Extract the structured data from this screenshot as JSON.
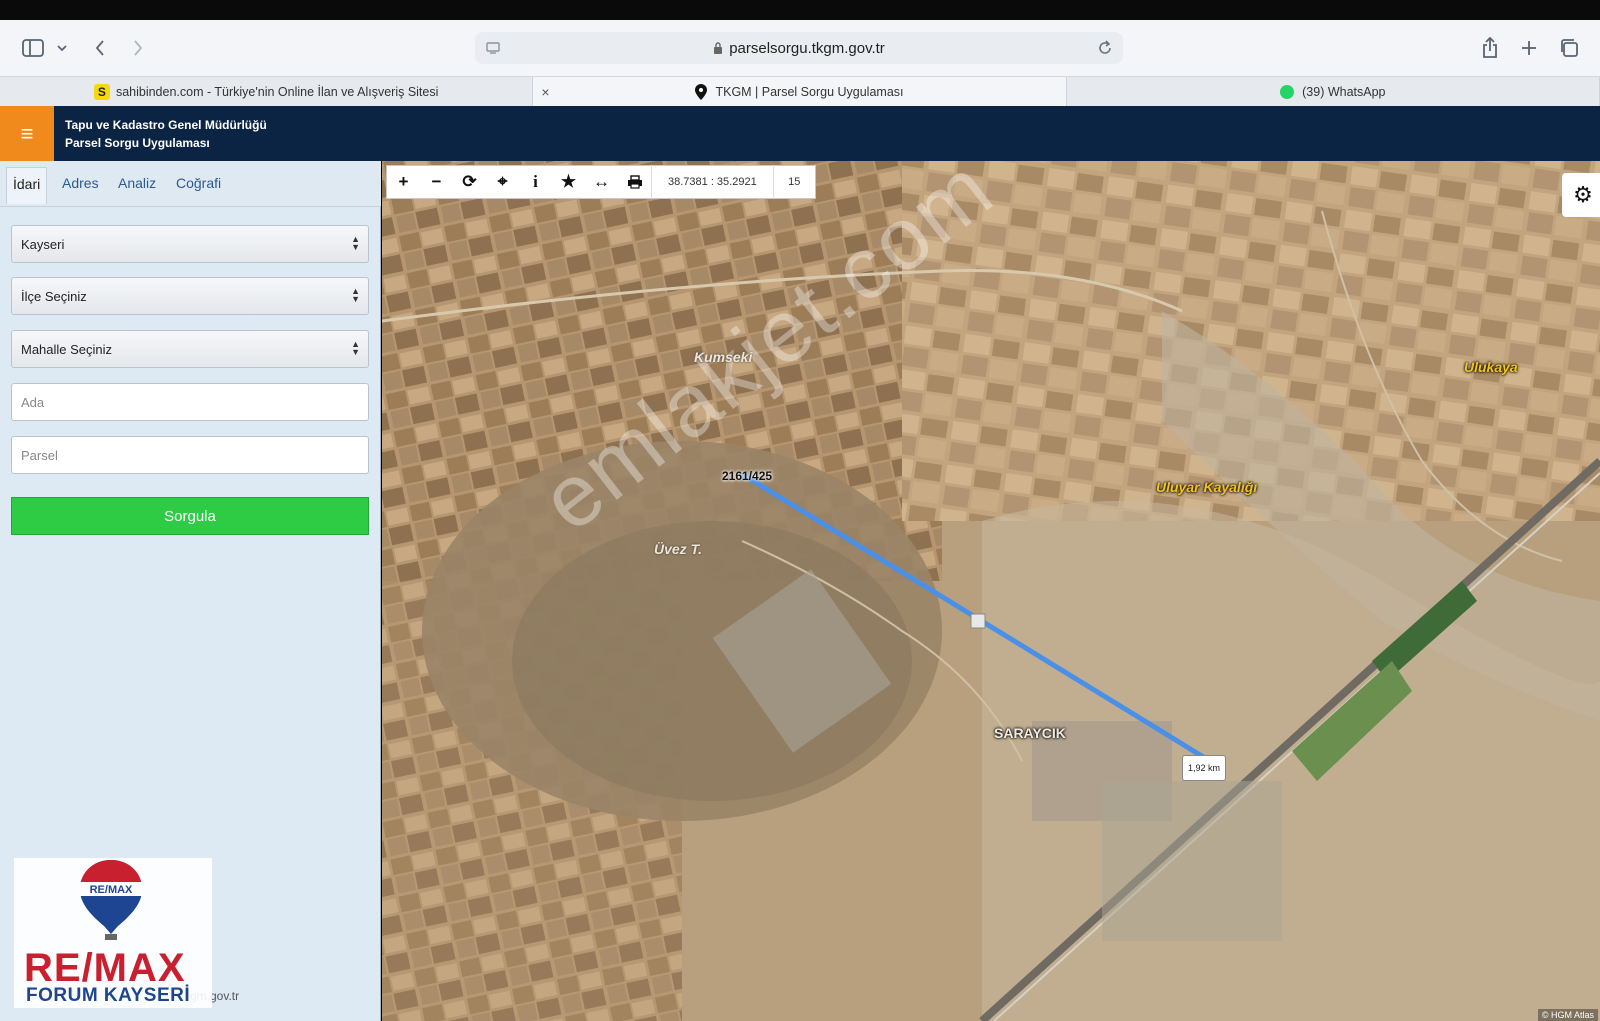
{
  "browser": {
    "url": "parselsorgu.tkgm.gov.tr",
    "tabs": [
      {
        "label": "sahibinden.com - Türkiye'nin Online İlan ve Alışveriş Sitesi",
        "favicon": "S"
      },
      {
        "label": "TKGM | Parsel Sorgu Uygulaması"
      },
      {
        "label": "(39) WhatsApp"
      }
    ]
  },
  "app": {
    "menu_icon": "≡",
    "title_line1": "Tapu ve Kadastro Genel Müdürlüğü",
    "title_line2": "Parsel Sorgu Uygulaması"
  },
  "panel": {
    "tabs": [
      "İdari",
      "Adres",
      "Analiz",
      "Coğrafi"
    ],
    "il_value": "Kayseri",
    "ilce_value": "İlçe Seçiniz",
    "mahalle_value": "Mahalle Seçiniz",
    "ada_placeholder": "Ada",
    "parsel_placeholder": "Parsel",
    "submit_label": "Sorgula",
    "footer_url": "gm.gov.tr"
  },
  "logo": {
    "ribbon": "RE/MAX",
    "brand": "RE/MAX",
    "office": "FORUM KAYSERİ"
  },
  "map": {
    "coords": "38.7381 : 35.2921",
    "zoom": "15",
    "parcel_label": "2161/425",
    "distance_label": "1,92 km",
    "watermark": "emlakjet.com",
    "attribution": "© HGM Atlas",
    "places": {
      "kumseki": "Kumseki",
      "ulukaya": "Ulukaya",
      "uluyar": "Uluyar Kayalığı",
      "uvez": "Üvez T.",
      "saraycik": "SARAYCIK"
    }
  },
  "colors": {
    "header_bg": "#0c2444",
    "menu_btn": "#f08a1c",
    "submit_btn": "#2ecb45",
    "measure_line": "#4a90e8"
  }
}
